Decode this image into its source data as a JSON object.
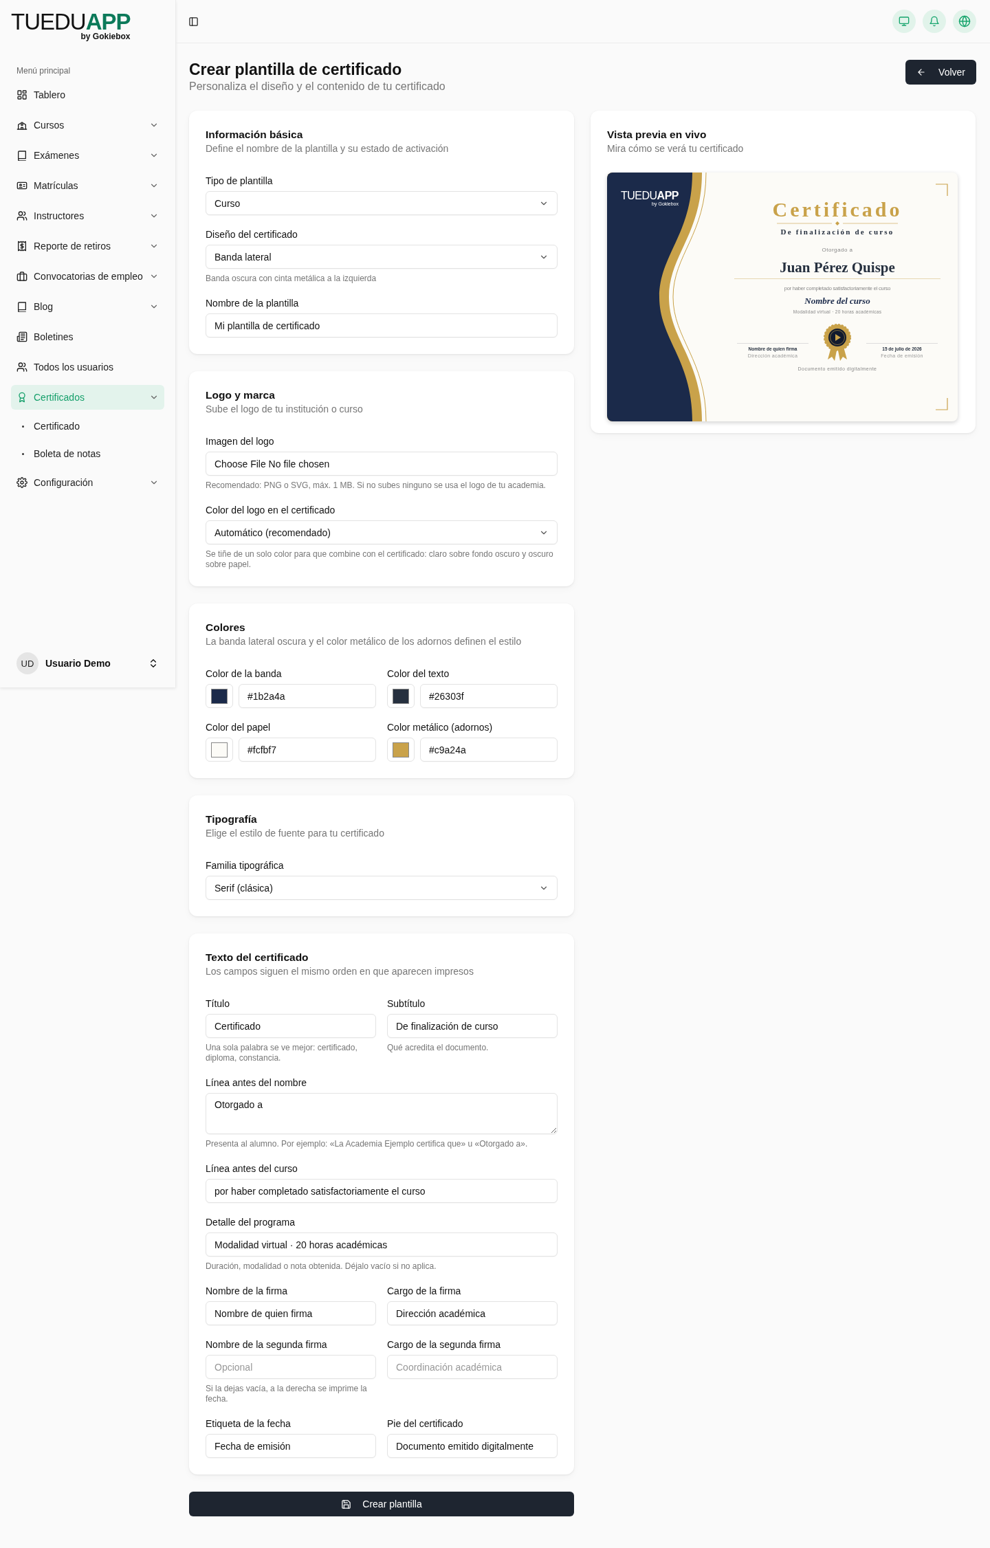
{
  "sidebar": {
    "logo": {
      "light": "TUEDU",
      "bold": "APP",
      "tagline": "by Gokiebox"
    },
    "section_label": "Menú principal",
    "items": [
      {
        "label": "Tablero",
        "expandable": false,
        "selected": false
      },
      {
        "label": "Cursos",
        "expandable": true,
        "selected": false
      },
      {
        "label": "Exámenes",
        "expandable": true,
        "selected": false
      },
      {
        "label": "Matrículas",
        "expandable": true,
        "selected": false
      },
      {
        "label": "Instructores",
        "expandable": true,
        "selected": false
      },
      {
        "label": "Reporte de retiros",
        "expandable": true,
        "selected": false
      },
      {
        "label": "Convocatorias de empleo",
        "expandable": true,
        "selected": false
      },
      {
        "label": "Blog",
        "expandable": true,
        "selected": false
      },
      {
        "label": "Boletines",
        "expandable": false,
        "selected": false
      },
      {
        "label": "Todos los usuarios",
        "expandable": false,
        "selected": false
      },
      {
        "label": "Certificados",
        "expandable": true,
        "selected": true,
        "children": [
          {
            "label": "Certificado",
            "selected": false
          },
          {
            "label": "Boleta de notas",
            "selected": false
          }
        ]
      },
      {
        "label": "Configuración",
        "expandable": true,
        "selected": false
      }
    ],
    "user": {
      "initials": "UD",
      "name": "Usuario Demo"
    }
  },
  "page": {
    "title": "Crear plantilla de certificado",
    "subtitle": "Personaliza el diseño y el contenido de tu certificado",
    "back_button": "Volver"
  },
  "sections": [
    {
      "title": "Información básica",
      "subtitle": "Define el nombre de la plantilla y su estado de activación",
      "rows": [
        [
          {
            "kind": "select",
            "label": "Tipo de plantilla",
            "value": "Curso"
          }
        ],
        [
          {
            "kind": "select",
            "label": "Diseño del certificado",
            "value": "Banda lateral",
            "hint": "Banda oscura con cinta metálica a la izquierda"
          }
        ],
        [
          {
            "kind": "text",
            "label": "Nombre de la plantilla",
            "value": "Mi plantilla de certificado"
          }
        ]
      ]
    },
    {
      "title": "Logo y marca",
      "subtitle": "Sube el logo de tu institución o curso",
      "rows": [
        [
          {
            "kind": "file",
            "label": "Imagen del logo",
            "button": "Choose File",
            "status": "No file chosen",
            "hint": "Recomendado: PNG o SVG, máx. 1 MB. Si no subes ninguno se usa el logo de tu academia."
          }
        ],
        [
          {
            "kind": "select",
            "label": "Color del logo en el certificado",
            "value": "Automático (recomendado)",
            "hint": "Se tiñe de un solo color para que combine con el certificado: claro sobre fondo oscuro y oscuro sobre papel."
          }
        ]
      ]
    },
    {
      "title": "Colores",
      "subtitle": "La banda lateral oscura y el color metálico de los adornos definen el estilo",
      "rows": [
        [
          {
            "kind": "color",
            "label": "Color de la banda",
            "value": "#1b2a4a"
          },
          {
            "kind": "color",
            "label": "Color del texto",
            "value": "#26303f"
          }
        ],
        [
          {
            "kind": "color",
            "label": "Color del papel",
            "value": "#fcfbf7"
          },
          {
            "kind": "color",
            "label": "Color metálico (adornos)",
            "value": "#c9a24a"
          }
        ]
      ]
    },
    {
      "title": "Tipografía",
      "subtitle": "Elige el estilo de fuente para tu certificado",
      "rows": [
        [
          {
            "kind": "select",
            "label": "Familia tipográfica",
            "value": "Serif (clásica)"
          }
        ]
      ]
    },
    {
      "title": "Texto del certificado",
      "subtitle": "Los campos siguen el mismo orden en que aparecen impresos",
      "rows": [
        [
          {
            "kind": "text",
            "label": "Título",
            "value": "Certificado",
            "hint": "Una sola palabra se ve mejor: certificado, diploma, constancia."
          },
          {
            "kind": "text",
            "label": "Subtítulo",
            "value": "De finalización de curso",
            "hint": "Qué acredita el documento."
          }
        ],
        [
          {
            "kind": "textarea",
            "label": "Línea antes del nombre",
            "value": "Otorgado a",
            "hint": "Presenta al alumno. Por ejemplo: «La Academia Ejemplo certifica que» u «Otorgado a»."
          }
        ],
        [
          {
            "kind": "text",
            "label": "Línea antes del curso",
            "value": "por haber completado satisfactoriamente el curso"
          }
        ],
        [
          {
            "kind": "text",
            "label": "Detalle del programa",
            "value": "Modalidad virtual · 20 horas académicas",
            "hint": "Duración, modalidad o nota obtenida. Déjalo vacío si no aplica."
          }
        ],
        [
          {
            "kind": "text",
            "label": "Nombre de la firma",
            "value": "Nombre de quien firma"
          },
          {
            "kind": "text",
            "label": "Cargo de la firma",
            "value": "Dirección académica"
          }
        ],
        [
          {
            "kind": "text",
            "label": "Nombre de la segunda firma",
            "placeholder": "Opcional",
            "hint": "Si la dejas vacía, a la derecha se imprime la fecha."
          },
          {
            "kind": "text",
            "label": "Cargo de la segunda firma",
            "placeholder": "Coordinación académica"
          }
        ],
        [
          {
            "kind": "text",
            "label": "Etiqueta de la fecha",
            "value": "Fecha de emisión"
          },
          {
            "kind": "text",
            "label": "Pie del certificado",
            "value": "Documento emitido digitalmente"
          }
        ]
      ]
    }
  ],
  "submit_button": "Crear plantilla",
  "preview": {
    "title": "Vista previa en vivo",
    "subtitle": "Mira cómo se verá tu certificado",
    "certificate": {
      "logo": {
        "light": "TUEDU",
        "bold": "APP",
        "tagline": "by Gokiebox"
      },
      "title": "Certificado",
      "subtitle": "De finalización de curso",
      "intro": "Otorgado a",
      "recipient": "Juan Pérez Quispe",
      "course_intro": "por haber completado satisfactoriamente el curso",
      "course_name": "Nombre del curso",
      "detail": "Modalidad virtual · 20 horas académicas",
      "signer_name": "Nombre de quien firma",
      "signer_role": "Dirección académica",
      "date": "15 de julio de 2026",
      "date_label": "Fecha de emisión",
      "footer": "Documento emitido digitalmente"
    }
  }
}
